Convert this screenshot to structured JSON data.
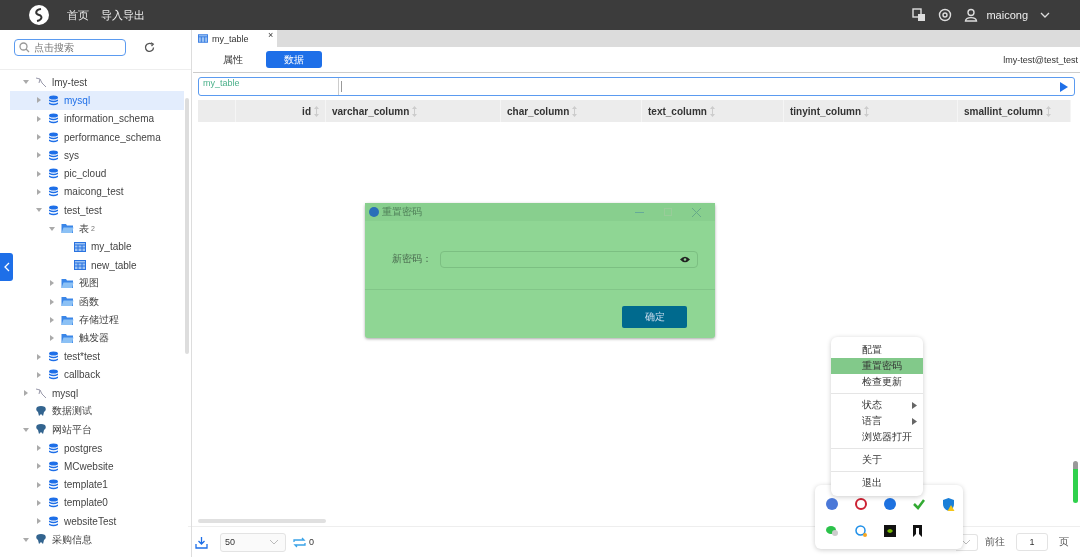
{
  "topbar": {
    "nav": [
      "首页",
      "导入导出"
    ],
    "user": "maicong"
  },
  "sidebar": {
    "search": {
      "placeholder": "点击搜索"
    },
    "tree": [
      {
        "label": "lmy-test",
        "kind": "connection",
        "expanded": true,
        "selected": false,
        "children": [
          {
            "label": "mysql",
            "kind": "database",
            "expanded": false,
            "selected": true
          },
          {
            "label": "information_schema",
            "kind": "database",
            "expanded": false,
            "selected": false
          },
          {
            "label": "performance_schema",
            "kind": "database",
            "expanded": false,
            "selected": false
          },
          {
            "label": "sys",
            "kind": "database",
            "expanded": false,
            "selected": false
          },
          {
            "label": "pic_cloud",
            "kind": "database",
            "expanded": false,
            "selected": false
          },
          {
            "label": "maicong_test",
            "kind": "database",
            "expanded": false,
            "selected": false
          },
          {
            "label": "test_test",
            "kind": "database",
            "expanded": true,
            "selected": false,
            "children": [
              {
                "label": "表",
                "count": "2",
                "kind": "folder",
                "expanded": true,
                "selected": false,
                "children": [
                  {
                    "label": "my_table",
                    "kind": "table",
                    "selected": false
                  },
                  {
                    "label": "new_table",
                    "kind": "table",
                    "selected": false
                  }
                ]
              },
              {
                "label": "视图",
                "kind": "folder",
                "expanded": false,
                "selected": false
              },
              {
                "label": "函数",
                "kind": "folder",
                "expanded": false,
                "selected": false
              },
              {
                "label": "存储过程",
                "kind": "folder",
                "expanded": false,
                "selected": false
              },
              {
                "label": "触发器",
                "kind": "folder",
                "expanded": false,
                "selected": false
              }
            ]
          },
          {
            "label": "test*test",
            "kind": "database",
            "expanded": false,
            "selected": false
          },
          {
            "label": "callback",
            "kind": "database",
            "expanded": false,
            "selected": false
          }
        ]
      },
      {
        "label": "mysql",
        "kind": "connection",
        "expanded": false,
        "selected": false
      },
      {
        "label": "数据测试",
        "kind": "pg",
        "selected": false
      },
      {
        "label": "网站平台",
        "kind": "pg",
        "expanded": true,
        "selected": false,
        "children": [
          {
            "label": "postgres",
            "kind": "database",
            "expanded": false,
            "selected": false
          },
          {
            "label": "MCwebsite",
            "kind": "database",
            "expanded": false,
            "selected": false
          },
          {
            "label": "template1",
            "kind": "database",
            "expanded": false,
            "selected": false
          },
          {
            "label": "template0",
            "kind": "database",
            "expanded": false,
            "selected": false
          },
          {
            "label": "websiteTest",
            "kind": "database",
            "expanded": false,
            "selected": false
          }
        ]
      },
      {
        "label": "采购信息",
        "kind": "pg",
        "expanded": true,
        "selected": false
      }
    ]
  },
  "doc_tab": {
    "label": "my_table",
    "close": "×"
  },
  "subtabs": [
    {
      "label": "属性",
      "selected": false
    },
    {
      "label": "数据",
      "selected": true
    }
  ],
  "connection": "lmy-test@test_test",
  "query": {
    "table": "my_table"
  },
  "table": {
    "columns": [
      {
        "label": "id"
      },
      {
        "label": "varchar_column"
      },
      {
        "label": "char_column"
      },
      {
        "label": "text_column"
      },
      {
        "label": "tinyint_column"
      },
      {
        "label": "smallint_column"
      }
    ]
  },
  "footer": {
    "page_size": "50",
    "count": "0",
    "goto": "前往",
    "page": "1",
    "page_unit": "页"
  },
  "dialog": {
    "title": "重置密码",
    "field_label": "新密码：",
    "confirm": "确定"
  },
  "menu": [
    {
      "label": "配置",
      "selected": false,
      "submenu": false,
      "divider_after": false
    },
    {
      "label": "重置密码",
      "selected": true,
      "submenu": false,
      "divider_after": false
    },
    {
      "label": "检查更新",
      "selected": false,
      "submenu": false,
      "divider_after": true
    },
    {
      "label": "状态",
      "selected": false,
      "submenu": true,
      "divider_after": false
    },
    {
      "label": "语言",
      "selected": false,
      "submenu": true,
      "divider_after": false
    },
    {
      "label": "浏览器打开",
      "selected": false,
      "submenu": false,
      "divider_after": true
    },
    {
      "label": "关于",
      "selected": false,
      "submenu": false,
      "divider_after": true
    },
    {
      "label": "退出",
      "selected": false,
      "submenu": false,
      "divider_after": false
    }
  ]
}
